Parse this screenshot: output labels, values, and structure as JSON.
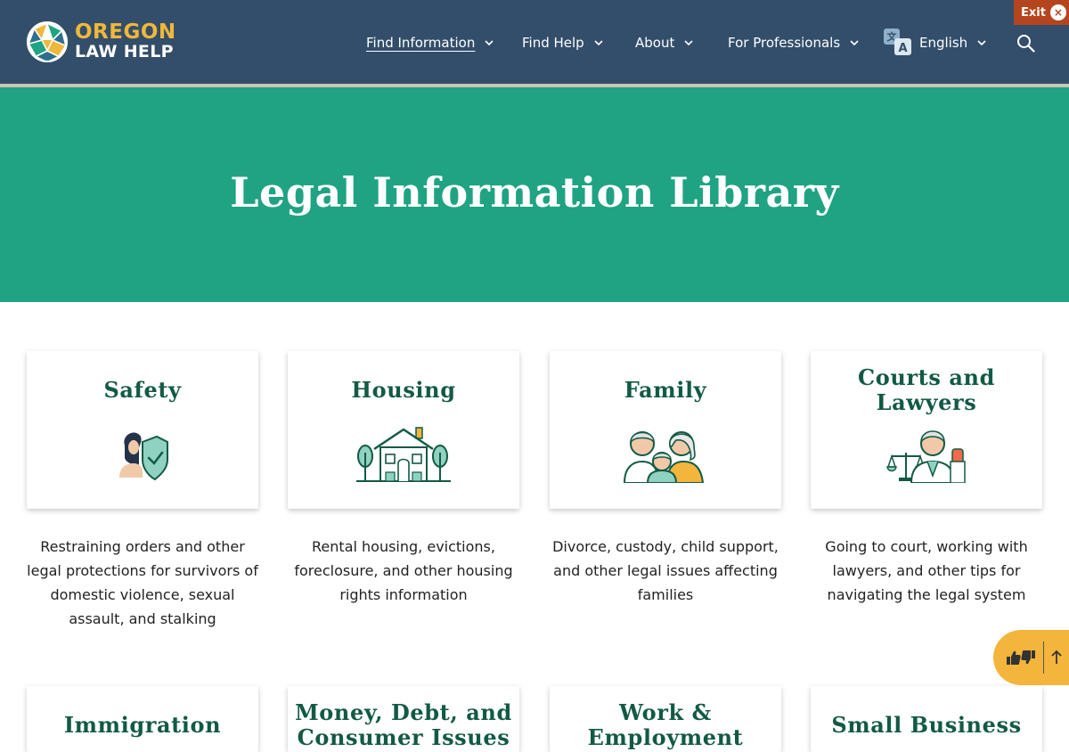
{
  "header": {
    "logo_line1": "OREGON",
    "logo_line2": "LAW HELP",
    "nav": [
      {
        "label": "Find Information",
        "active": true
      },
      {
        "label": "Find Help"
      },
      {
        "label": "About"
      },
      {
        "label": "For Professionals"
      }
    ],
    "language": "English",
    "exit_label": "Exit",
    "exit_x": "×"
  },
  "hero": {
    "title": "Legal Information Library"
  },
  "cards": [
    {
      "title": "Safety",
      "icon": "safety-shield-icon",
      "description": "Restraining orders and other legal protections for survivors of domestic violence, sexual assault, and stalking"
    },
    {
      "title": "Housing",
      "icon": "house-icon",
      "description": "Rental housing, evictions, foreclosure, and other housing rights information"
    },
    {
      "title": "Family",
      "icon": "family-icon",
      "description": "Divorce, custody, child support, and other legal issues affecting families"
    },
    {
      "title": "Courts and Lawyers",
      "icon": "courts-lawyers-icon",
      "description": "Going to court, working with lawyers, and other tips for navigating the legal system"
    },
    {
      "title": "Immigration"
    },
    {
      "title": "Money, Debt, and Consumer Issues"
    },
    {
      "title": "Work & Employment"
    },
    {
      "title": "Small Business"
    }
  ],
  "colors": {
    "header_bg": "#334e6a",
    "hero_bg": "#20a383",
    "title_green": "#125a45",
    "logo_gold": "#f0b73a",
    "exit_bg": "#b5451e",
    "feedback_bg": "#f3b53c"
  }
}
